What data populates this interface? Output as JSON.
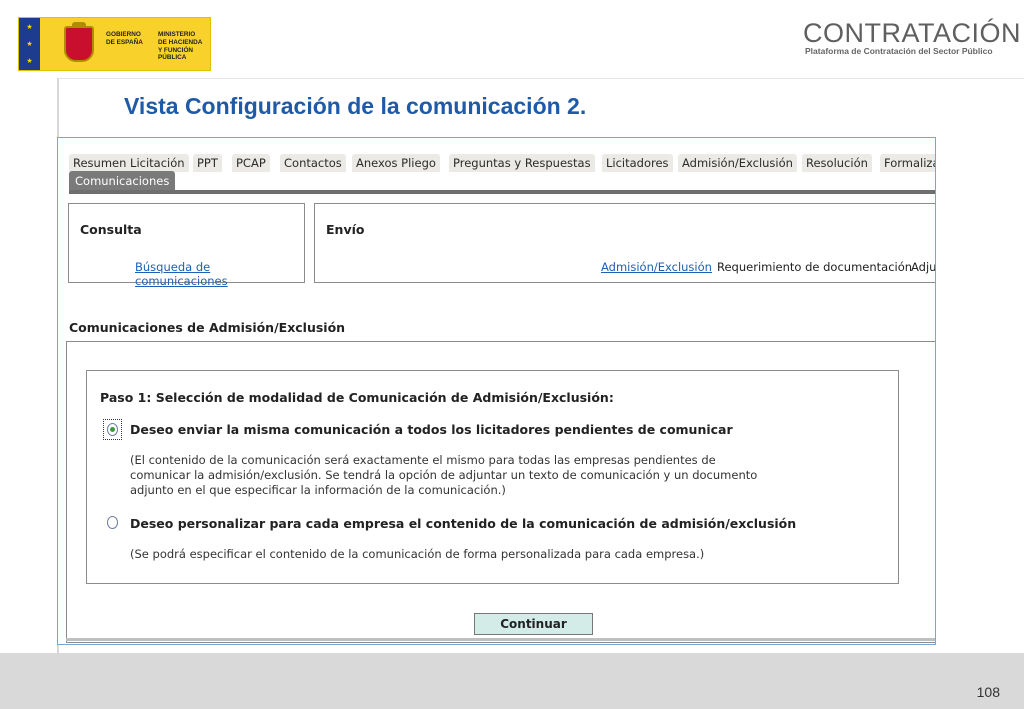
{
  "header": {
    "gov_logo": {
      "line1": "GOBIERNO",
      "line2": "DE ESPAÑA",
      "line3": "MINISTERIO",
      "line4": "DE HACIENDA",
      "line5": "Y FUNCIÓN PÚBLICA"
    },
    "contratacion_logo": {
      "word": "CONTRATACIÓN",
      "subtitle": "Plataforma de Contratación del Sector Público"
    }
  },
  "slide_title": "Vista Configuración de la comunicación 2.",
  "tabs": [
    {
      "label": "Resumen Licitación"
    },
    {
      "label": "PPT"
    },
    {
      "label": "PCAP"
    },
    {
      "label": "Contactos"
    },
    {
      "label": "Anexos Pliego"
    },
    {
      "label": "Preguntas y Respuestas"
    },
    {
      "label": "Licitadores"
    },
    {
      "label": "Admisión/Exclusión"
    },
    {
      "label": "Resolución"
    },
    {
      "label": "Formaliza"
    }
  ],
  "active_tab": {
    "label": "Comunicaciones"
  },
  "consulta": {
    "title": "Consulta",
    "link": "Búsqueda de comunicaciones"
  },
  "envio": {
    "title": "Envío",
    "link": "Admisión/Exclusión",
    "text1": "Requerimiento de documentación",
    "text2": "Adju"
  },
  "section_title": "Comunicaciones de Admisión/Exclusión",
  "step": {
    "title": "Paso 1: Selección de modalidad de Comunicación de Admisión/Exclusión:",
    "option1": {
      "label": "Deseo enviar la misma comunicación a todos los licitadores pendientes de comunicar",
      "desc1": "(El contenido de la comunicación será exactamente el mismo para todas las empresas pendientes de",
      "desc2": "comunicar la admisión/exclusión. Se tendrá la opción de adjuntar un texto de comunicación y un documento",
      "desc3": "adjunto en el que especificar la información de la comunicación.)",
      "selected": true
    },
    "option2": {
      "label": "Deseo personalizar para cada empresa el contenido de la comunicación de admisión/exclusión",
      "desc1": "(Se podrá especificar el contenido de la comunicación de forma personalizada para cada empresa.)",
      "selected": false
    }
  },
  "continue_button": "Continuar",
  "page_number": "108",
  "colors": {
    "title_blue": "#1e5aa8",
    "link_blue": "#1f5fb5",
    "button_bg": "#d3ece8",
    "active_tab_bg": "#7a7a7a",
    "radio_selected": "#3d9a3d"
  }
}
